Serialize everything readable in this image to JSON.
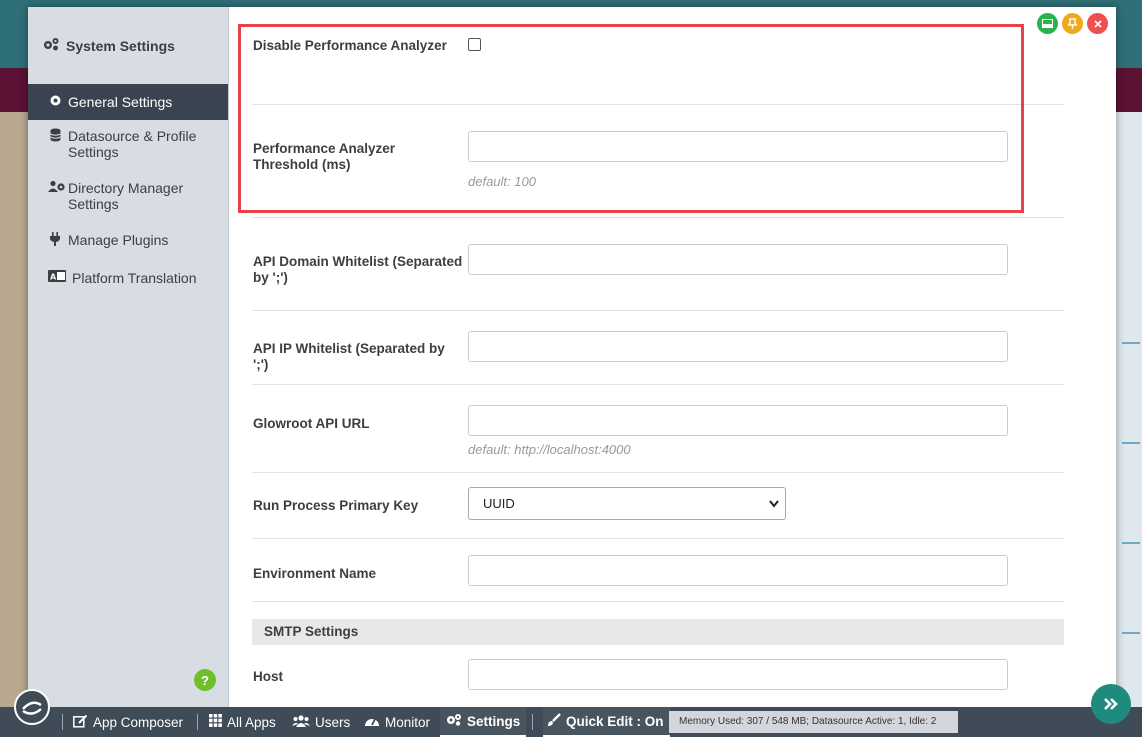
{
  "window": {
    "controls": [
      {
        "name": "minimize",
        "icon": "window-minimize-icon",
        "color": "#2bb24c"
      },
      {
        "name": "pin",
        "icon": "pin-icon",
        "color": "#f0a81c"
      },
      {
        "name": "close",
        "icon": "close-icon",
        "color": "#ef4f4f"
      }
    ]
  },
  "sidebar": {
    "title": "System Settings",
    "title_icon": "gears-icon",
    "items": [
      {
        "label": "General Settings",
        "icon": "gear-icon",
        "active": true
      },
      {
        "label": "Datasource & Profile Settings",
        "icon": "database-icon",
        "active": false
      },
      {
        "label": "Directory Manager Settings",
        "icon": "users-gear-icon",
        "active": false
      },
      {
        "label": "Manage Plugins",
        "icon": "plug-icon",
        "active": false
      },
      {
        "label": "Platform Translation",
        "icon": "language-icon",
        "active": false
      }
    ],
    "help_label": "?"
  },
  "form": {
    "disable_perf": {
      "label": "Disable Performance Analyzer",
      "checked": false
    },
    "perf_threshold": {
      "label": "Performance Analyzer Threshold (ms)",
      "value": "",
      "hint": "default: 100"
    },
    "api_domain": {
      "label": "API Domain Whitelist (Separated by ';')",
      "value": ""
    },
    "api_ip": {
      "label": "API IP Whitelist (Separated by ';')",
      "value": ""
    },
    "glowroot": {
      "label": "Glowroot API URL",
      "value": "",
      "hint": "default: http://localhost:4000"
    },
    "run_process": {
      "label": "Run Process Primary Key",
      "selected": "UUID"
    },
    "env_name": {
      "label": "Environment Name",
      "value": ""
    },
    "smtp_section": "SMTP Settings",
    "host": {
      "label": "Host",
      "value": ""
    }
  },
  "taskbar": {
    "items": [
      {
        "label": "App Composer",
        "icon": "edit-icon"
      },
      {
        "label": "All Apps",
        "icon": "grid-icon"
      },
      {
        "label": "Users",
        "icon": "users-icon"
      },
      {
        "label": "Monitor",
        "icon": "gauge-icon"
      },
      {
        "label": "Settings",
        "icon": "gears-icon",
        "active": true
      },
      {
        "label": "Quick Edit : On",
        "icon": "brush-icon"
      }
    ],
    "status": "Memory Used: 307 / 548 MB; Datasource Active: 1, Idle: 2"
  },
  "colors": {
    "accent": "#3a4450",
    "highlight": "#e8424a",
    "taskbar": "#3f4b56"
  }
}
